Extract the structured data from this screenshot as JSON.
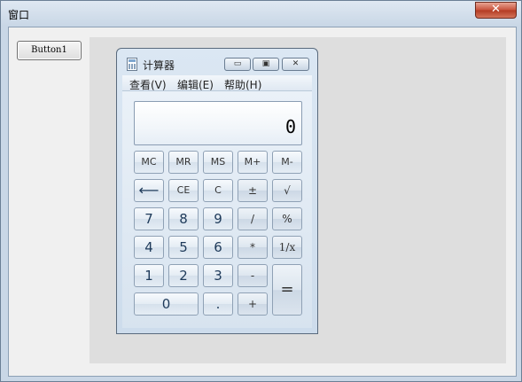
{
  "window": {
    "title": "窗口",
    "close_label": "✕"
  },
  "button1": {
    "label": "Button1"
  },
  "calculator": {
    "title": "计算器",
    "controls": {
      "minimize": "▭",
      "maximize": "▣",
      "close": "✕"
    },
    "menu": [
      "查看(V)",
      "编辑(E)",
      "帮助(H)"
    ],
    "display": "0",
    "keys": {
      "mc": "MC",
      "mr": "MR",
      "ms": "MS",
      "mplus": "M+",
      "mminus": "M-",
      "back": "⟵",
      "ce": "CE",
      "c": "C",
      "plusminus": "±",
      "sqrt": "√",
      "k7": "7",
      "k8": "8",
      "k9": "9",
      "div": "/",
      "percent": "%",
      "k4": "4",
      "k5": "5",
      "k6": "6",
      "mul": "*",
      "recip": "1/x",
      "k1": "1",
      "k2": "2",
      "k3": "3",
      "sub": "-",
      "equals": "=",
      "k0": "0",
      "dot": ".",
      "add": "+"
    }
  }
}
